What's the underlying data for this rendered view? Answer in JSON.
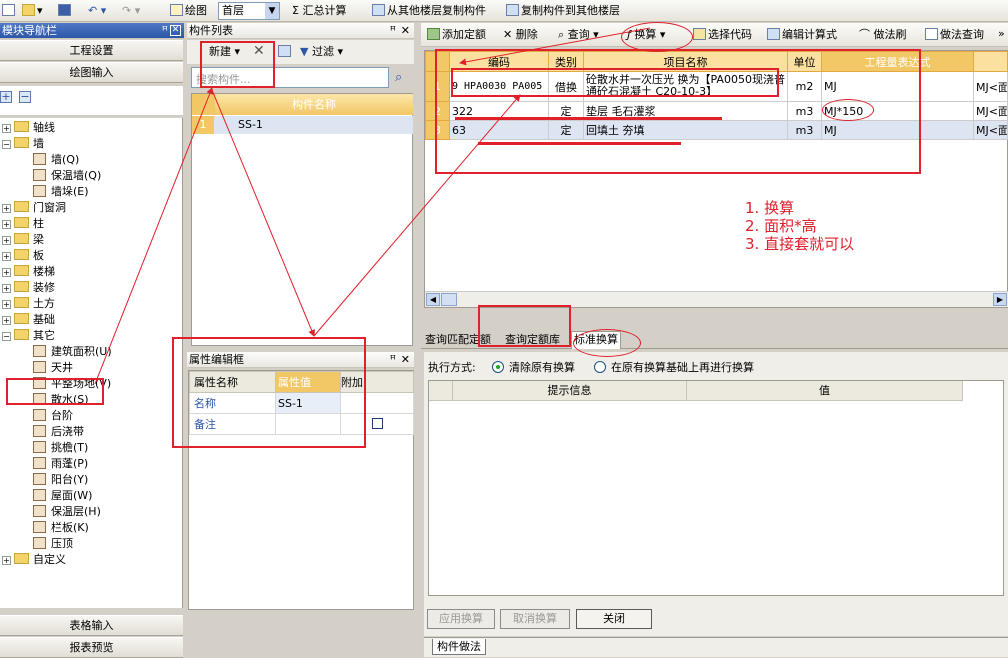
{
  "toolbar": {
    "draw_label": "绘图",
    "floor_value": "首层",
    "sum_calc": "汇总计算",
    "copy_from": "从其他楼层复制构件",
    "copy_to": "复制构件到其他楼层"
  },
  "nav": {
    "title": "模块导航栏",
    "project_settings": "工程设置",
    "drawing_input": "绘图输入",
    "table_input": "表格输入",
    "report_preview": "报表预览",
    "tree": [
      {
        "label": "轴线",
        "level": 0,
        "icon": "folder-icon",
        "exp": "+"
      },
      {
        "label": "墙",
        "level": 0,
        "icon": "folder-icon",
        "exp": "-"
      },
      {
        "label": "墙(Q)",
        "level": 1,
        "icon": "wall-icon"
      },
      {
        "label": "保温墙(Q)",
        "level": 1,
        "icon": "insulation-wall-icon"
      },
      {
        "label": "墙垛(E)",
        "level": 1,
        "icon": "wall-pier-icon"
      },
      {
        "label": "门窗洞",
        "level": 0,
        "icon": "folder-icon",
        "exp": "+"
      },
      {
        "label": "柱",
        "level": 0,
        "icon": "folder-icon",
        "exp": "+"
      },
      {
        "label": "梁",
        "level": 0,
        "icon": "folder-icon",
        "exp": "+"
      },
      {
        "label": "板",
        "level": 0,
        "icon": "folder-icon",
        "exp": "+"
      },
      {
        "label": "楼梯",
        "level": 0,
        "icon": "folder-icon",
        "exp": "+"
      },
      {
        "label": "装修",
        "level": 0,
        "icon": "folder-icon",
        "exp": "+"
      },
      {
        "label": "土方",
        "level": 0,
        "icon": "folder-icon",
        "exp": "+"
      },
      {
        "label": "基础",
        "level": 0,
        "icon": "folder-icon",
        "exp": "+"
      },
      {
        "label": "其它",
        "level": 0,
        "icon": "folder-icon",
        "exp": "-"
      },
      {
        "label": "建筑面积(U)",
        "level": 1,
        "icon": "building-area-icon"
      },
      {
        "label": "天井",
        "level": 1,
        "icon": "patio-icon"
      },
      {
        "label": "平整场地(V)",
        "level": 1,
        "icon": "site-leveling-icon"
      },
      {
        "label": "散水(S)",
        "level": 1,
        "icon": "apron-icon"
      },
      {
        "label": "台阶",
        "level": 1,
        "icon": "steps-icon"
      },
      {
        "label": "后浇带",
        "level": 1,
        "icon": "post-cast-strip-icon"
      },
      {
        "label": "挑檐(T)",
        "level": 1,
        "icon": "eave-icon"
      },
      {
        "label": "雨蓬(P)",
        "level": 1,
        "icon": "canopy-icon"
      },
      {
        "label": "阳台(Y)",
        "level": 1,
        "icon": "balcony-icon"
      },
      {
        "label": "屋面(W)",
        "level": 1,
        "icon": "roof-icon"
      },
      {
        "label": "保温层(H)",
        "level": 1,
        "icon": "insulation-layer-icon"
      },
      {
        "label": "栏板(K)",
        "level": 1,
        "icon": "parapet-icon"
      },
      {
        "label": "压顶",
        "level": 1,
        "icon": "coping-icon"
      },
      {
        "label": "自定义",
        "level": 0,
        "icon": "folder-icon",
        "exp": "+"
      }
    ]
  },
  "component_list": {
    "title": "构件列表",
    "new_label": "新建",
    "filter_label": "过滤",
    "search_placeholder": "搜索构件...",
    "header": "构件名称",
    "rows": [
      {
        "index": "1",
        "name": "SS-1"
      }
    ]
  },
  "properties": {
    "title": "属性编辑框",
    "col_name": "属性名称",
    "col_value": "属性值",
    "col_extra": "附加",
    "rows": [
      {
        "name": "名称",
        "value": "SS-1"
      },
      {
        "name": "备注",
        "value": ""
      }
    ]
  },
  "quota_toolbar": {
    "add_quota": "添加定额",
    "delete": "删除",
    "query": "查询",
    "convert": "换算",
    "select_code": "选择代码",
    "edit_formula": "编辑计算式",
    "method_brush": "做法刷",
    "method_query": "做法查询"
  },
  "quota_table": {
    "columns": [
      "编码",
      "类别",
      "项目名称",
      "单位",
      "工程量表达式",
      ""
    ],
    "rows": [
      {
        "num": "1",
        "code": "9 HPA0030 PA005",
        "category": "借换",
        "name": "砼散水并一次压光 换为【PA0050现浇普通砼石混凝土 C20-10-3】",
        "unit": "m2",
        "expr": "MJ",
        "extra": "MJ<面"
      },
      {
        "num": "2",
        "code": "322",
        "category": "定",
        "name": "垫层 毛石灌浆",
        "unit": "m3",
        "expr": "MJ*150",
        "extra": "MJ<面"
      },
      {
        "num": "3",
        "code": "63",
        "category": "定",
        "name": "回填土 夯填",
        "unit": "m3",
        "expr": "MJ",
        "extra": "MJ<面"
      }
    ]
  },
  "notes": [
    "1. 换算",
    "2. 面积*高",
    "3. 直接套就可以"
  ],
  "bottom_tabs": [
    "查询匹配定额",
    "查询定额库",
    "标准换算"
  ],
  "conversion": {
    "exec_label": "执行方式:",
    "option1": "清除原有换算",
    "option2": "在原有换算基础上再进行换算",
    "col_hint": "提示信息",
    "col_value": "值",
    "apply": "应用换算",
    "cancel": "取消换算",
    "close": "关闭"
  },
  "bottom_tab": "构件做法",
  "colors": {
    "annotation": "#e0202a",
    "header_orange": "#f2c766",
    "accent_blue": "#2c56a8"
  }
}
